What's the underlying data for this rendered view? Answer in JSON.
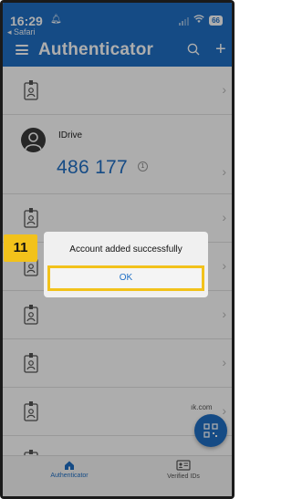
{
  "status_bar": {
    "time": "16:29",
    "back_label": "◂ Safari",
    "battery": "66"
  },
  "header": {
    "title": "Authenticator"
  },
  "account": {
    "name": "IDrive",
    "code": "486 177",
    "timer": "1"
  },
  "trailing_text": "ık.com",
  "dialog": {
    "message": "Account added successfully",
    "ok_label": "OK"
  },
  "step_badge": "11",
  "tabs": [
    {
      "label": "Authenticator",
      "active": true
    },
    {
      "label": "Verified IDs",
      "active": false
    }
  ],
  "colors": {
    "brand": "#1f6fc5",
    "highlight": "#f2c21b"
  }
}
